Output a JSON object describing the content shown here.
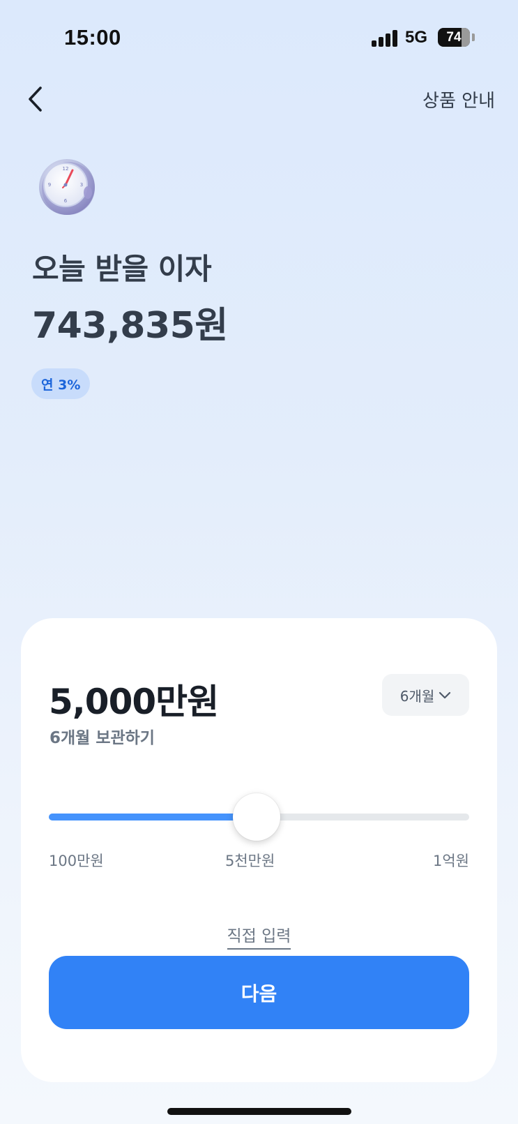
{
  "status_bar": {
    "time": "15:00",
    "network": "5G",
    "battery": "74"
  },
  "header": {
    "back_icon": "chevron-left-icon",
    "info_link": "상품 안내"
  },
  "hero": {
    "icon": "clock-icon",
    "title": "오늘 받을 이자",
    "amount": "743,835원",
    "rate_badge": "연 3%"
  },
  "card": {
    "amount": "5,000만원",
    "subtitle": "6개월 보관하기",
    "period_select": {
      "value": "6개월",
      "icon": "chevron-down-icon"
    },
    "slider": {
      "progress": 0.495,
      "min_label": "100만원",
      "mid_label": "5천만원",
      "max_label": "1억원"
    },
    "direct_input": "직접 입력",
    "next_button": "다음"
  },
  "colors": {
    "accent": "#3182f6",
    "slider_fill": "#4593fc",
    "badge_bg": "#c8dcfb",
    "badge_text": "#1b64da",
    "title_text": "#333d4b"
  }
}
